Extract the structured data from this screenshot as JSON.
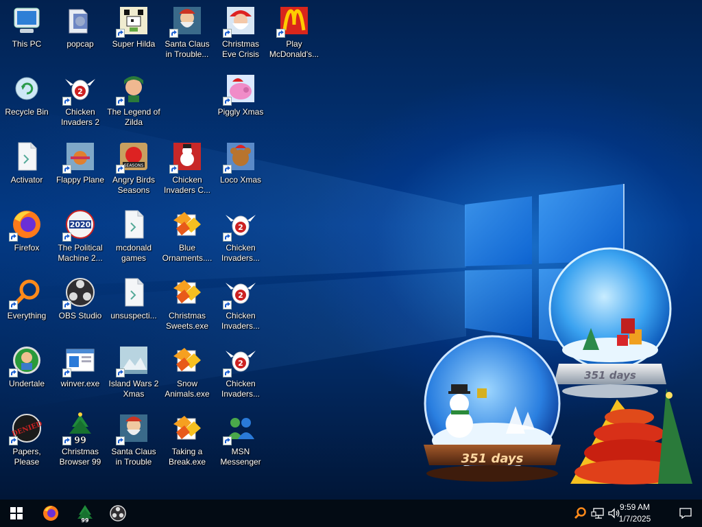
{
  "desktop": {
    "icons": [
      {
        "label": "This PC",
        "icon": "this-pc-icon",
        "shortcut": false
      },
      {
        "label": "popcap",
        "icon": "folder-icon",
        "shortcut": false
      },
      {
        "label": "Super Hilda",
        "icon": "pixel-dog-icon",
        "shortcut": true
      },
      {
        "label": "Santa Claus in Trouble... A...",
        "icon": "santa-icon",
        "shortcut": true
      },
      {
        "label": "Christmas Eve Crisis",
        "icon": "santa-face-icon",
        "shortcut": true
      },
      {
        "label": "Play McDonald's...",
        "icon": "mcdonalds-icon",
        "shortcut": true
      },
      {
        "label": "Recycle Bin",
        "icon": "recycle-bin-icon",
        "shortcut": false
      },
      {
        "label": "Chicken Invaders 2",
        "icon": "chicken-icon",
        "shortcut": true
      },
      {
        "label": "The Legend of Zilda",
        "icon": "zilda-icon",
        "shortcut": true
      },
      {
        "label": "Piggly Xmas",
        "icon": "pig-icon",
        "shortcut": true
      },
      {
        "label": "Activator",
        "icon": "file-icon",
        "shortcut": false
      },
      {
        "label": "Flappy Plane",
        "icon": "plane-icon",
        "shortcut": true
      },
      {
        "label": "Angry Birds Seasons",
        "icon": "angry-birds-icon",
        "shortcut": true
      },
      {
        "label": "Chicken Invaders C...",
        "icon": "snowman-chicken-icon",
        "shortcut": true
      },
      {
        "label": "Loco Xmas",
        "icon": "bear-icon",
        "shortcut": true
      },
      {
        "label": "Firefox",
        "icon": "firefox-icon",
        "shortcut": true
      },
      {
        "label": "The Political Machine 2...",
        "icon": "political-machine-icon",
        "shortcut": true
      },
      {
        "label": "mcdonald games",
        "icon": "file-icon",
        "shortcut": false
      },
      {
        "label": "Blue Ornaments....",
        "icon": "puzzle-exe-icon",
        "shortcut": false
      },
      {
        "label": "Chicken Invaders...",
        "icon": "chicken-icon",
        "shortcut": true
      },
      {
        "label": "Everything",
        "icon": "everything-icon",
        "shortcut": true
      },
      {
        "label": "OBS Studio",
        "icon": "obs-icon",
        "shortcut": true
      },
      {
        "label": "unsuspecti...",
        "icon": "file-icon",
        "shortcut": false
      },
      {
        "label": "Christmas Sweets.exe",
        "icon": "puzzle-exe-icon",
        "shortcut": false
      },
      {
        "label": "Chicken Invaders...",
        "icon": "chicken-icon",
        "shortcut": true
      },
      {
        "label": "Undertale",
        "icon": "undertale-icon",
        "shortcut": true
      },
      {
        "label": "winver.exe",
        "icon": "winver-icon",
        "shortcut": true
      },
      {
        "label": "Island Wars 2 Xmas",
        "icon": "island-icon",
        "shortcut": true
      },
      {
        "label": "Snow Animals.exe",
        "icon": "puzzle-exe-icon",
        "shortcut": false
      },
      {
        "label": "Chicken Invaders...",
        "icon": "chicken-icon",
        "shortcut": true
      },
      {
        "label": "Papers, Please",
        "icon": "papers-please-icon",
        "shortcut": true
      },
      {
        "label": "Christmas Browser 99",
        "icon": "xmas-tree-99-icon",
        "shortcut": true
      },
      {
        "label": "Santa Claus in Trouble",
        "icon": "santa-icon",
        "shortcut": true
      },
      {
        "label": "Taking a Break.exe",
        "icon": "puzzle-exe-icon",
        "shortcut": false
      },
      {
        "label": "MSN Messenger",
        "icon": "msn-icon",
        "shortcut": true
      }
    ],
    "globes": {
      "left_label": "351 days",
      "right_label": "351 days"
    }
  },
  "taskbar": {
    "start": "windows-start-icon",
    "pinned": [
      "firefox-icon",
      "xmas-tree-99-icon",
      "obs-icon"
    ],
    "tray": {
      "icons": [
        "everything-icon",
        "network-icon",
        "volume-icon"
      ],
      "time": "9:59 AM",
      "date": "1/7/2025",
      "notification": "notification-icon"
    }
  },
  "colors": {
    "wallpaper_dark": "#01173f",
    "wallpaper_light": "#2b8fff",
    "taskbar": "#030b14"
  }
}
